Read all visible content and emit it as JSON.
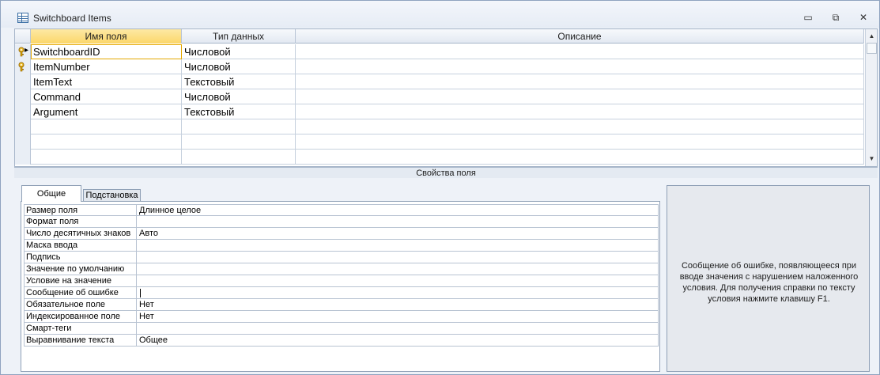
{
  "window": {
    "title": "Switchboard Items",
    "controls": {
      "minimize": "▭",
      "restore": "⧉",
      "close": "✕"
    }
  },
  "grid": {
    "headers": [
      "Имя поля",
      "Тип данных",
      "Описание"
    ],
    "rows": [
      {
        "name": "SwitchboardID",
        "type": "Числовой",
        "description": "",
        "primary_key": true,
        "current": true
      },
      {
        "name": "ItemNumber",
        "type": "Числовой",
        "description": "",
        "primary_key": true,
        "current": false
      },
      {
        "name": "ItemText",
        "type": "Текстовый",
        "description": "",
        "primary_key": false,
        "current": false
      },
      {
        "name": "Command",
        "type": "Числовой",
        "description": "",
        "primary_key": false,
        "current": false
      },
      {
        "name": "Argument",
        "type": "Текстовый",
        "description": "",
        "primary_key": false,
        "current": false
      },
      {
        "name": "",
        "type": "",
        "description": "",
        "primary_key": false,
        "current": false
      },
      {
        "name": "",
        "type": "",
        "description": "",
        "primary_key": false,
        "current": false
      },
      {
        "name": "",
        "type": "",
        "description": "",
        "primary_key": false,
        "current": false
      }
    ]
  },
  "properties_bar": {
    "label": "Свойства поля"
  },
  "tabs": {
    "general": "Общие",
    "lookup": "Подстановка"
  },
  "properties": [
    {
      "label": "Размер поля",
      "value": "Длинное целое"
    },
    {
      "label": "Формат поля",
      "value": ""
    },
    {
      "label": "Число десятичных знаков",
      "value": "Авто"
    },
    {
      "label": "Маска ввода",
      "value": ""
    },
    {
      "label": "Подпись",
      "value": ""
    },
    {
      "label": "Значение по умолчанию",
      "value": ""
    },
    {
      "label": "Условие на значение",
      "value": ""
    },
    {
      "label": "Сообщение об ошибке",
      "value": ""
    },
    {
      "label": "Обязательное поле",
      "value": "Нет"
    },
    {
      "label": "Индексированное поле",
      "value": "Нет"
    },
    {
      "label": "Смарт-теги",
      "value": ""
    },
    {
      "label": "Выравнивание текста",
      "value": "Общее"
    }
  ],
  "help": {
    "text": "Сообщение об ошибке, появляющееся при вводе значения с нарушением наложенного условия. Для получения справки по тексту условия нажмите клавишу F1."
  },
  "icons": {
    "table": "table-icon",
    "key": "primary-key-icon"
  },
  "colors": {
    "active_header": "#fbd66a",
    "grid_border": "#a6b5c9",
    "window_bg": "#eef2f8"
  }
}
